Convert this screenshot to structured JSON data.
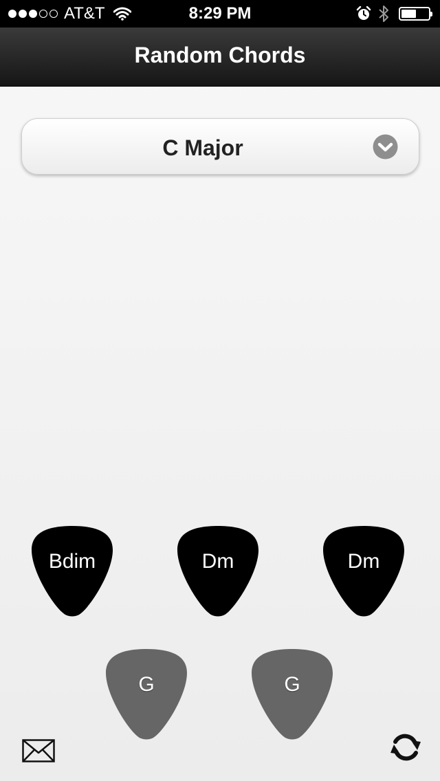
{
  "status_bar": {
    "signal_bars_full": 3,
    "signal_bars_total": 5,
    "carrier": "AT&T",
    "time": "8:29 PM",
    "battery_level": 0.5,
    "icons": [
      "wifi-icon",
      "alarm-icon",
      "bluetooth-icon",
      "battery-icon"
    ]
  },
  "header": {
    "title": "Random Chords"
  },
  "key_selector": {
    "selected": "C Major",
    "icon": "chevron-down-icon"
  },
  "chord_picks": {
    "row1": [
      {
        "chord": "Bdim",
        "color": "#000000"
      },
      {
        "chord": "Dm",
        "color": "#000000"
      },
      {
        "chord": "Dm",
        "color": "#000000"
      }
    ],
    "row2": [
      {
        "chord": "G",
        "color": "#666666"
      },
      {
        "chord": "G",
        "color": "#666666"
      }
    ]
  },
  "toolbar": {
    "left_icon": "mail-icon",
    "right_icon": "refresh-icon"
  }
}
